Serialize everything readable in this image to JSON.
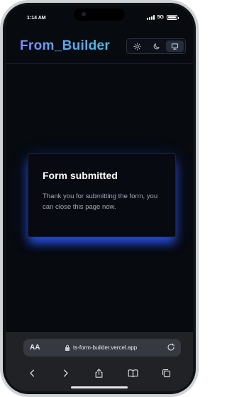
{
  "status_bar": {
    "time": "1:14 AM",
    "network": "5G"
  },
  "header": {
    "brand": "From_Builder",
    "theme_options": [
      "light",
      "dark",
      "system"
    ],
    "active_theme": "system"
  },
  "card": {
    "title": "Form submitted",
    "body": "Thank you for submitting the form, you can close this page now."
  },
  "browser": {
    "text_size_label": "AA",
    "url": "ts-form-builder.vercel.app",
    "toolbar_icons": [
      "back-icon",
      "forward-icon",
      "share-icon",
      "bookmarks-icon",
      "tabs-icon"
    ]
  },
  "colors": {
    "background": "#070a0f",
    "brand_gradient_start": "#7b8cff",
    "brand_gradient_end": "#43c1e6",
    "card_glow": "#2c58ff"
  }
}
